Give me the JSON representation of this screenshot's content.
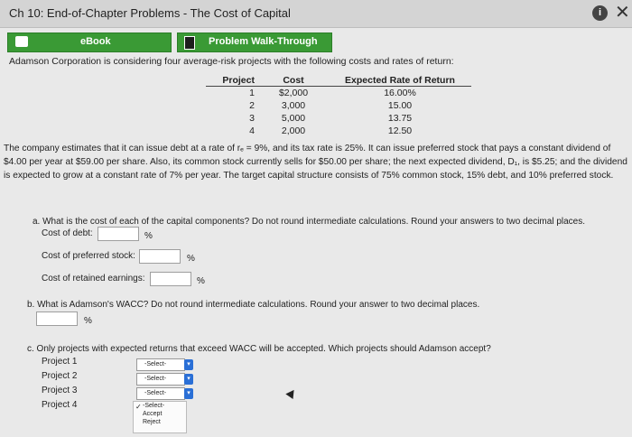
{
  "window": {
    "title": "Ch 10: End-of-Chapter Problems - The Cost of Capital"
  },
  "tabs": {
    "ebook": "eBook",
    "problem_walk": "Problem Walk-Through"
  },
  "intro": "Adamson Corporation is considering four average-risk projects with the following costs and rates of return:",
  "table": {
    "headers": [
      "Project",
      "Cost",
      "Expected Rate of Return"
    ],
    "rows": [
      [
        "1",
        "$2,000",
        "16.00%"
      ],
      [
        "2",
        "3,000",
        "15.00"
      ],
      [
        "3",
        "5,000",
        "13.75"
      ],
      [
        "4",
        "2,000",
        "12.50"
      ]
    ]
  },
  "paragraph": "The company estimates that it can issue debt at a rate of rₑ = 9%, and its tax rate is 25%. It can issue preferred stock that pays a constant dividend of $4.00 per year at $59.00 per share. Also, its common stock currently sells for $50.00 per share; the next expected dividend, D₁, is $5.25; and the dividend is expected to grow at a constant rate of 7% per year. The target capital structure consists of 75% common stock, 15% debt, and 10% preferred stock.",
  "question_a": {
    "prompt": "a. What is the cost of each of the capital components? Do not round intermediate calculations. Round your answers to two decimal places.",
    "debt_label": "Cost of debt:",
    "preferred_label": "Cost of preferred stock:",
    "retained_label": "Cost of retained earnings:",
    "unit": "%"
  },
  "question_b": {
    "prompt": "b. What is Adamson's WACC? Do not round intermediate calculations. Round your answer to two decimal places.",
    "unit": "%"
  },
  "question_c": {
    "prompt": "c. Only projects with expected returns that exceed WACC will be accepted. Which projects should Adamson accept?",
    "projects": [
      "Project 1",
      "Project 2",
      "Project 3",
      "Project 4"
    ],
    "select_value": "-Select-",
    "options": [
      "-Select-",
      "Accept",
      "Reject"
    ]
  },
  "icons": {
    "info": "info-icon",
    "close": "close-icon",
    "ebook": "book-icon",
    "walk": "walkthrough-icon"
  }
}
